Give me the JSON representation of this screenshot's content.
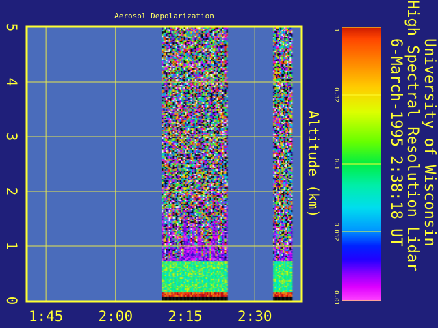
{
  "chart_data": {
    "type": "heatmap",
    "title": "Aerosol Depolarization",
    "ylabel": "Altitude (km)",
    "xlabel": "",
    "x_ticks": [
      "1:45",
      "2:00",
      "2:15",
      "2:30"
    ],
    "x_tick_minutes": [
      105,
      120,
      135,
      150
    ],
    "xlim_minutes": [
      101,
      160
    ],
    "y_ticks": [
      "0",
      "1",
      "2",
      "3",
      "4",
      "5"
    ],
    "y_tick_values": [
      0,
      1,
      2,
      3,
      4,
      5
    ],
    "ylim": [
      0,
      5
    ],
    "grid": true,
    "data_segments": [
      {
        "start": "2:10",
        "end": "2:24",
        "start_minutes": 130,
        "end_minutes": 144
      },
      {
        "start": "2:34",
        "end": "2:38",
        "start_minutes": 154,
        "end_minutes": 158
      }
    ],
    "layers": {
      "ground_km": 0.1,
      "aerosol_top_km": 0.75,
      "plume_top_km": 1.8
    },
    "colorbar": {
      "scale": "log",
      "range": [
        0.01,
        1
      ],
      "ticks": [
        "1",
        "0.32",
        "0.1",
        "0.032",
        "0.01"
      ],
      "tick_values": [
        1,
        0.32,
        0.1,
        0.032,
        0.01
      ]
    }
  },
  "info": {
    "line1": "University of Wisconsin",
    "line2": "High Spectral Resolution Lidar",
    "line3": "6-March-1995  2:38:18 UT"
  },
  "colors": {
    "background": "#1f1f7a",
    "plot_background": "#4a6cbb",
    "frame": "#ffff33",
    "grid": "#e6e64d"
  }
}
